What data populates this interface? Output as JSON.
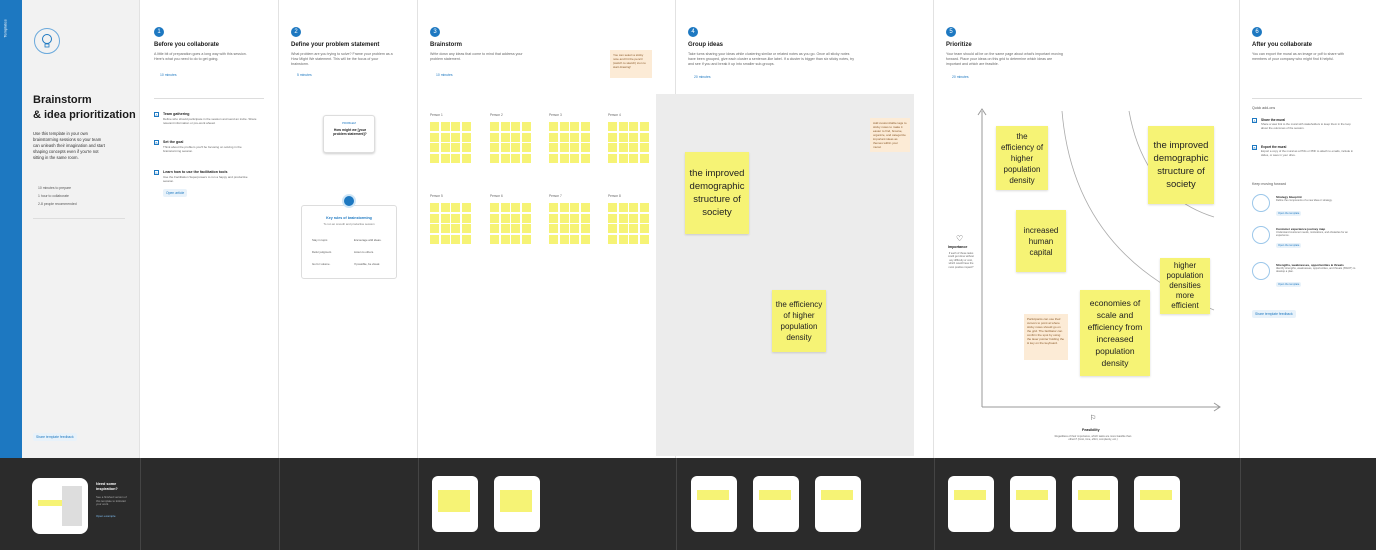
{
  "sidebar": {
    "tab": "Templates",
    "title1": "Brainstorm",
    "title2": "& idea prioritization",
    "desc": "Use this template in your own brainstorming sessions so your team can unleash their imagination and start shaping concepts even if you're not sitting in the same room.",
    "meta": [
      "10 minutes to prepare",
      "1 hour to collaborate",
      "2-8 people recommended"
    ],
    "share": "Share template feedback"
  },
  "step1": {
    "num": "1",
    "title": "Before you collaborate",
    "desc": "A little bit of preparation goes a long way with this session. Here's what you need to do to get going.",
    "time": "10 minutes",
    "items": [
      {
        "n": "A",
        "h": "Team gathering",
        "d": "Define who should participate in the session and send an invite. Share relevant information or pre-work ahead."
      },
      {
        "n": "B",
        "h": "Set the goal",
        "d": "Think about the problem you'll be focusing on solving in the brainstorming session."
      },
      {
        "n": "C",
        "h": "Learn how to use the facilitation tools",
        "d": "Use the Facilitation Superpowers to run a happy and productive session."
      }
    ],
    "link": "Open article"
  },
  "step2": {
    "num": "2",
    "title": "Define your problem statement",
    "desc": "What problem are you trying to solve? Frame your problem as a How Might We statement. This will be the focus of your brainstorm.",
    "time": "5 minutes",
    "card_label": "PROBLEM",
    "card_text": "How might we [your problem statement]?",
    "tips_title": "Key rules of brainstorming",
    "tips_sub": "To run an smooth and productive session",
    "tips": [
      "Stay in topic.",
      "Encourage wild ideas.",
      "Defer judgment.",
      "Listen to others.",
      "Go for volume.",
      "If possible, be visual."
    ]
  },
  "step3": {
    "num": "3",
    "title": "Brainstorm",
    "desc": "Write down any ideas that come to mind that address your problem statement.",
    "time": "10 minutes",
    "note": "You can select a sticky note and hit the pencil (switch to sketch) icon to start drawing!",
    "persons": [
      "Person 1",
      "Person 2",
      "Person 3",
      "Person 4",
      "Person 5",
      "Person 6",
      "Person 7",
      "Person 8"
    ]
  },
  "step4": {
    "num": "4",
    "title": "Group ideas",
    "desc": "Take turns sharing your ideas while clustering similar or related notes as you go. Once all sticky notes have been grouped, give each cluster a sentence-like label. If a cluster is bigger than six sticky notes, try and see if you and break it up into smaller sub-groups.",
    "time": "20 minutes",
    "note": "Add customizable tags to sticky notes to make it easier to find, browse, organize, and categorize important ideas as themes within your mural.",
    "sticky1": "the improved demographic structure of society",
    "sticky2": "the efficiency of higher population density"
  },
  "step5": {
    "num": "5",
    "title": "Prioritize",
    "desc": "Your team should all be on the same page about what's important moving forward. Place your ideas on this grid to determine which ideas are important and which are feasible.",
    "time": "20 minutes",
    "y_label": "Importance",
    "y_desc": "If each of these tasks could get done without any difficulty or cost, which would have the most positive impact?",
    "x_label": "Feasibility",
    "x_desc": "Regardless of their importance, which tasks are more feasible than others? (Cost, time, effort, complexity, etc.)",
    "note": "Participants can use their cursors to point at where sticky notes should go on the grid. The facilitator can confirm the spot by using the laser pointer holding the H key on the keyboard.",
    "stickies": [
      "the efficiency of higher population density",
      "the improved demographic structure of society",
      "increased human capital",
      "higher population densities more efficient",
      "economies of scale and efficiency from increased population density"
    ]
  },
  "step6": {
    "num": "6",
    "title": "After you collaborate",
    "desc": "You can export the mural as an image or pdf to share with members of your company who might find it helpful.",
    "quick": "Quick add-ons",
    "qa": [
      {
        "n": "A",
        "h": "Share the mural",
        "d": "Share a view link to the mural with stakeholders to keep them in the loop about the outcomes of the session."
      },
      {
        "n": "B",
        "h": "Export the mural",
        "d": "Export a copy of the mural as a PNG or PDF to attach to emails, include in slides, or save in your drive."
      }
    ],
    "keep": "Keep moving forward",
    "templates": [
      {
        "h": "Strategy blueprint",
        "d": "Define the components of a new idea or strategy.",
        "l": "Open the template"
      },
      {
        "h": "Customer experience journey map",
        "d": "Understand customer needs, motivations, and obstacles for an experience.",
        "l": "Open the template"
      },
      {
        "h": "Strengths, weaknesses, opportunities & threats",
        "d": "Identify strengths, weaknesses, opportunities, and threats (SWOT) to develop a plan.",
        "l": "Open the template"
      }
    ],
    "share": "Share template feedback"
  },
  "footer": {
    "need": "Need some inspiration?",
    "needd": "See a finished version of this template to kickstart your work.",
    "open": "Open example"
  },
  "colors": {
    "accent": "#1d78c1",
    "sticky": "#f6f375",
    "footer": "#2b2b2b"
  }
}
